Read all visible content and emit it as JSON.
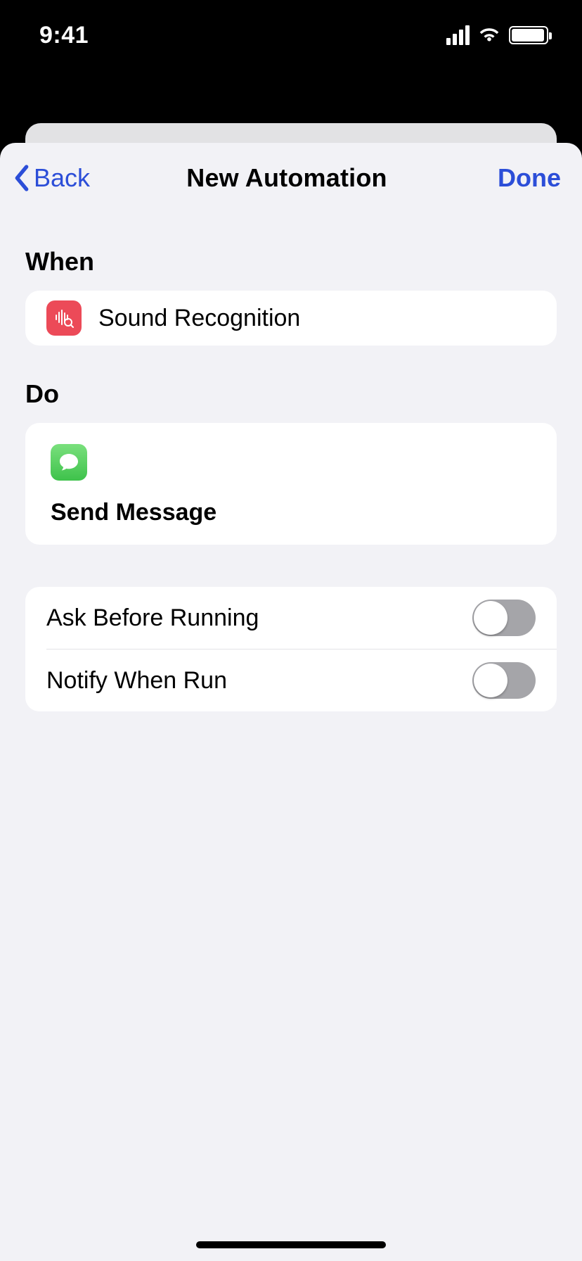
{
  "status": {
    "time": "9:41"
  },
  "nav": {
    "back": "Back",
    "title": "New Automation",
    "done": "Done"
  },
  "sections": {
    "when": {
      "header": "When",
      "item_label": "Sound Recognition"
    },
    "do": {
      "header": "Do",
      "action_label": "Send Message"
    }
  },
  "options": {
    "ask_before_running": {
      "label": "Ask Before Running",
      "on": false
    },
    "notify_when_run": {
      "label": "Notify When Run",
      "on": false
    }
  }
}
